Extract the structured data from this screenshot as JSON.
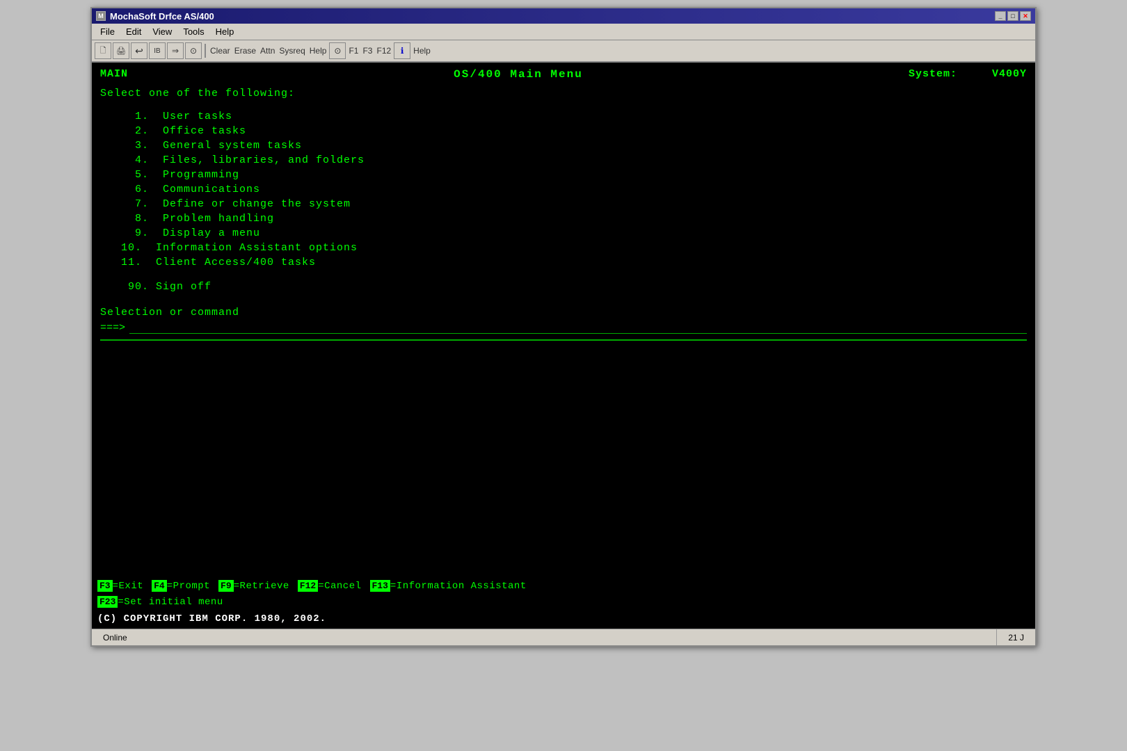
{
  "window": {
    "title": "MochaSoft Drfce AS/400",
    "title_bar_controls": [
      "_",
      "□",
      "✕"
    ]
  },
  "menu_bar": {
    "items": [
      "File",
      "Edit",
      "View",
      "Tools",
      "Help"
    ]
  },
  "toolbar": {
    "buttons": [
      "📄",
      "🖨",
      "↩",
      "🖫",
      "⊙",
      "Clear",
      "Erase",
      "Attn",
      "Sysreq",
      "Help",
      "⊙",
      "F1",
      "F3",
      "F12",
      "ℹ Help"
    ]
  },
  "terminal": {
    "main_label": "MAIN",
    "title": "OS/400 Main Menu",
    "system_label": "System:",
    "system_value": "V400Y",
    "select_prompt": "Select one of the following:",
    "menu_items": [
      {
        "number": "1.",
        "label": "User tasks"
      },
      {
        "number": "2.",
        "label": "Office tasks"
      },
      {
        "number": "3.",
        "label": "General system tasks"
      },
      {
        "number": "4.",
        "label": "Files, libraries, and folders"
      },
      {
        "number": "5.",
        "label": "Programming"
      },
      {
        "number": "6.",
        "label": "Communications"
      },
      {
        "number": "7.",
        "label": "Define or change the system"
      },
      {
        "number": "8.",
        "label": "Problem handling"
      },
      {
        "number": "9.",
        "label": "Display a menu"
      },
      {
        "number": "10.",
        "label": "Information Assistant options"
      },
      {
        "number": "11.",
        "label": "Client Access/400 tasks"
      }
    ],
    "sign_off": {
      "number": "90.",
      "label": "Sign off"
    },
    "selection_label": "Selection or command",
    "prompt_arrow": "===>",
    "input_value": ""
  },
  "fkeys": {
    "row1": [
      {
        "key": "F3",
        "separator": "=",
        "label": "Exit"
      },
      {
        "key": "F4",
        "separator": "=",
        "label": "Prompt"
      },
      {
        "key": "F9",
        "separator": "=",
        "label": "Retrieve"
      },
      {
        "key": "F12",
        "separator": "=",
        "label": "Cancel"
      },
      {
        "key": "F13",
        "separator": "=",
        "label": "Information Assistant"
      }
    ],
    "row2": [
      {
        "key": "F23",
        "separator": "=",
        "label": "Set initial menu"
      }
    ]
  },
  "copyright": "(C) COPYRIGHT IBM CORP. 1980, 2002.",
  "status_bar": {
    "main": "Online",
    "right": "21 J"
  }
}
